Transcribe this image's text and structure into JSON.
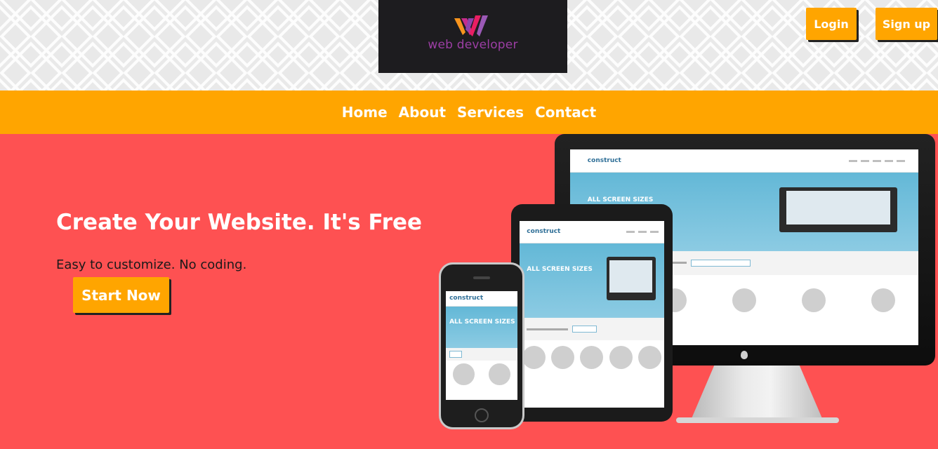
{
  "header": {
    "logo_text": "web developer",
    "login_label": "Login",
    "signup_label": "Sign up"
  },
  "nav": {
    "items": [
      "Home",
      "About",
      "Services",
      "Contact"
    ]
  },
  "hero": {
    "title": "Create Your Website. It's Free",
    "subtitle": "Easy to customize. No coding.",
    "cta_label": "Start Now"
  },
  "device_screens": {
    "brand": "construct",
    "headline": "ALL SCREEN SIZES"
  },
  "colors": {
    "accent_orange": "#ffa500",
    "hero_red": "#fe5152",
    "logo_bg": "#1d1c1f",
    "logo_purple": "#9c3ea4"
  },
  "icons": [
    "web-developer-logo-mark",
    "apple-logo-icon"
  ]
}
